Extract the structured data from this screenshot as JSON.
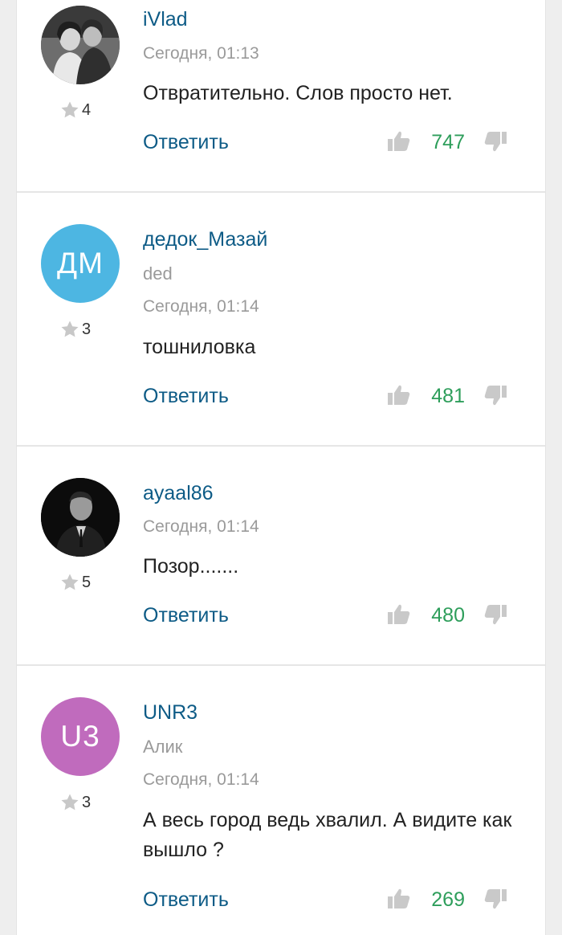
{
  "colors": {
    "link": "#0d5b86",
    "muted": "#9a9a9a",
    "positive_score": "#2e9e5b",
    "avatar_dm": "#4db6e2",
    "avatar_u3": "#c06bbd"
  },
  "icons": {
    "rating": "star-icon",
    "like": "thumbs-up-icon",
    "dislike": "thumbs-down-icon"
  },
  "comments": [
    {
      "username": "iVlad",
      "subname": "",
      "avatar_type": "photo",
      "rating": "4",
      "time": "Сегодня, 01:13",
      "text": "Отвратительно. Слов просто нет.",
      "reply_label": "Ответить",
      "score": "747"
    },
    {
      "username": "дедок_Мазай",
      "subname": "ded",
      "avatar_type": "initials",
      "avatar_initials": "ДМ",
      "rating": "3",
      "time": "Сегодня, 01:14",
      "text": "тошниловка",
      "reply_label": "Ответить",
      "score": "481"
    },
    {
      "username": "ayaal86",
      "subname": "",
      "avatar_type": "photo",
      "rating": "5",
      "time": "Сегодня, 01:14",
      "text": "Позор.......",
      "reply_label": "Ответить",
      "score": "480"
    },
    {
      "username": "UNR3",
      "subname": "Алик",
      "avatar_type": "initials",
      "avatar_initials": "U3",
      "rating": "3",
      "time": "Сегодня, 01:14",
      "text": "А весь город ведь хвалил. А видите как вышло ?",
      "reply_label": "Ответить",
      "score": "269"
    }
  ]
}
